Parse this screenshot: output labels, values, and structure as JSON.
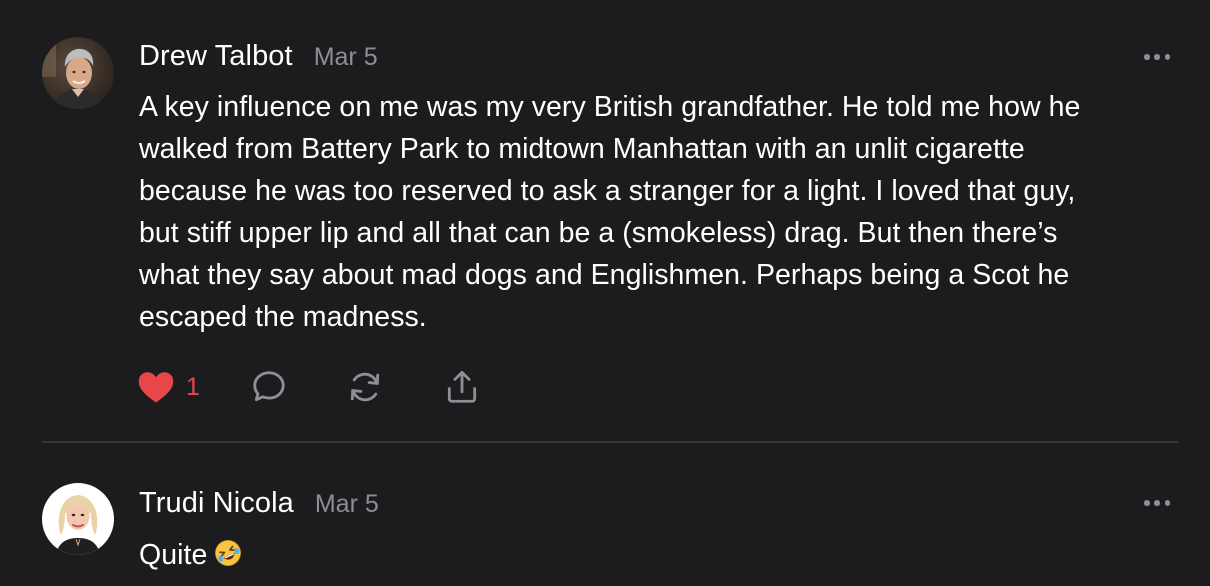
{
  "comments": [
    {
      "author": "Drew Talbot",
      "date": "Mar 5",
      "avatar_icon": "profile-photo-man-gray-hair",
      "lines": [
        "A key influence on me was my very British grandfather. He told me how he",
        "walked from Battery Park to midtown Manhattan with an unlit cigarette",
        "because he was too reserved to ask a stranger for a light. I loved that guy,",
        "but stiff upper lip and all that can be a (smokeless) drag. But then there’s",
        "what they say about mad dogs and Englishmen. Perhaps being a Scot he",
        "escaped the madness."
      ],
      "like_count": "1",
      "liked": true,
      "actions": [
        "heart-icon",
        "comment-icon",
        "restack-icon",
        "share-icon"
      ]
    },
    {
      "author": "Trudi Nicola",
      "date": "Mar 5",
      "avatar_icon": "illustrated-avatar-woman-blonde",
      "text": "Quite",
      "emoji": "rolling-on-floor-laughing-emoji"
    }
  ],
  "colors": {
    "background": "#1c1c1e",
    "text": "#ffffff",
    "muted": "#8e8e93",
    "like_red": "#e8474a",
    "divider": "#38383a"
  }
}
